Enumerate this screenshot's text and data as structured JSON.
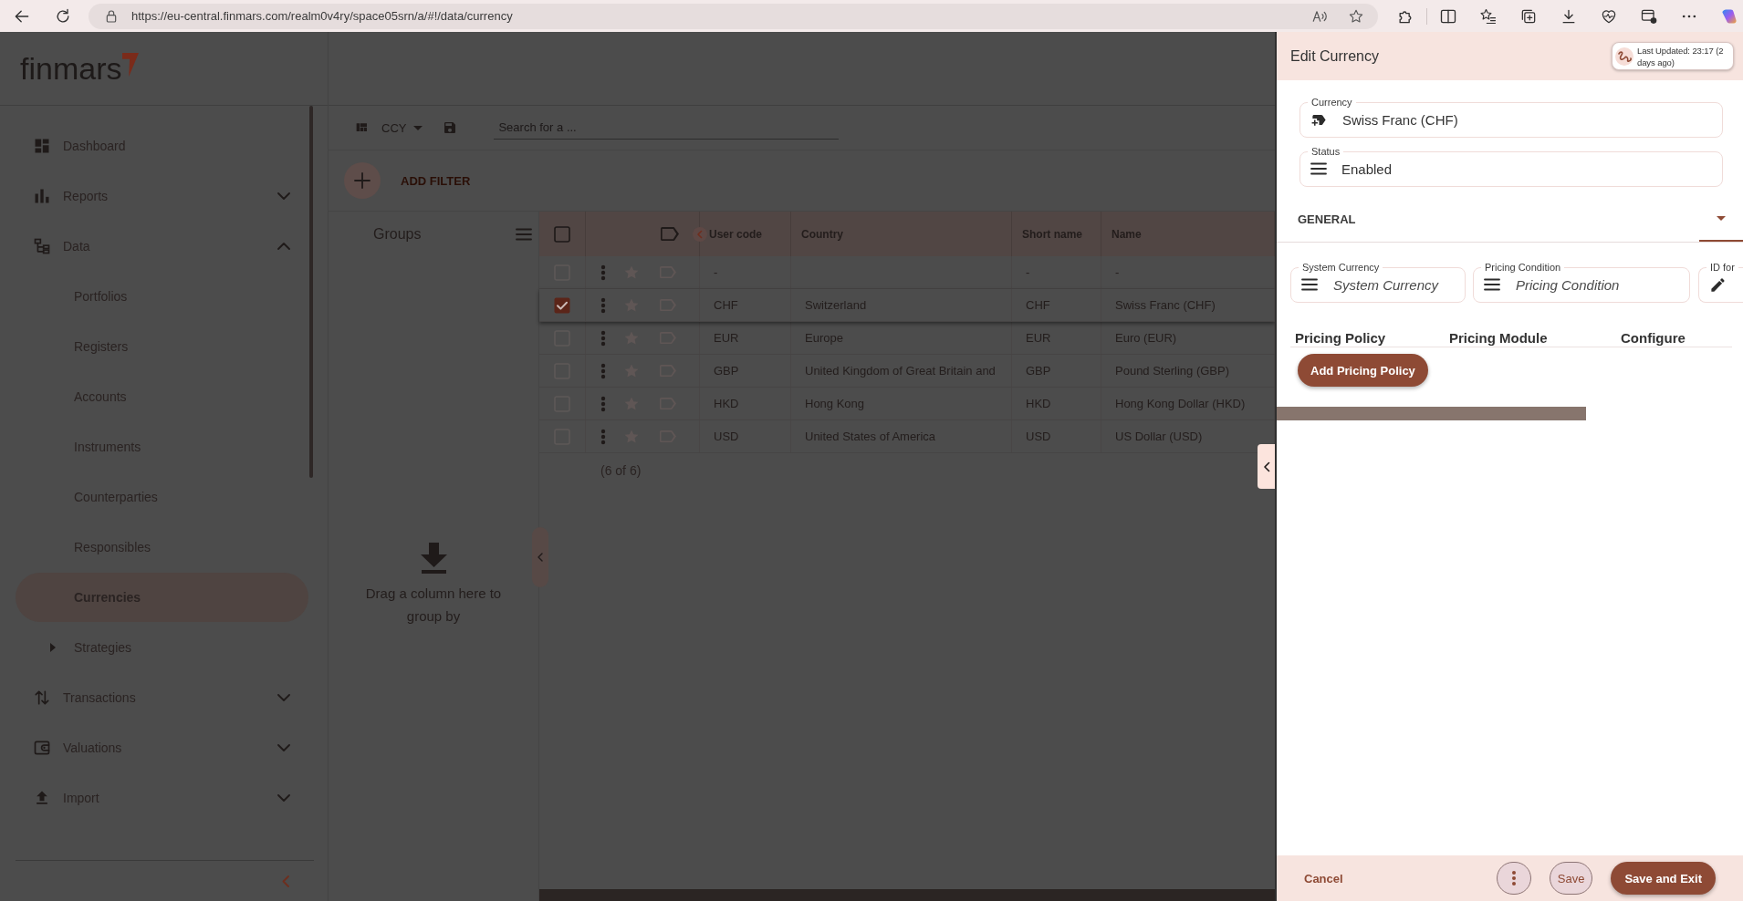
{
  "browser": {
    "url": "https://eu-central.finmars.com/realm0v4ry/space05srn/a/#!/data/currency"
  },
  "sidebar": {
    "logo": "finmars",
    "items": [
      {
        "kind": "link",
        "label": "Dashboard",
        "selected": false
      },
      {
        "kind": "group",
        "label": "Reports",
        "selected": false,
        "expanded": false
      },
      {
        "kind": "group",
        "label": "Data",
        "selected": false,
        "expanded": true,
        "children": [
          {
            "kind": "link",
            "label": "Portfolios",
            "selected": false
          },
          {
            "kind": "link",
            "label": "Registers",
            "selected": false
          },
          {
            "kind": "link",
            "label": "Accounts",
            "selected": false
          },
          {
            "kind": "link",
            "label": "Instruments",
            "selected": false
          },
          {
            "kind": "link",
            "label": "Counterparties",
            "selected": false
          },
          {
            "kind": "link",
            "label": "Responsibles",
            "selected": false
          },
          {
            "kind": "link",
            "label": "Currencies",
            "selected": true
          },
          {
            "kind": "group",
            "label": "Strategies",
            "selected": false,
            "expanded": false
          }
        ]
      },
      {
        "kind": "group",
        "label": "Transactions",
        "selected": false,
        "expanded": false
      },
      {
        "kind": "group",
        "label": "Valuations",
        "selected": false,
        "expanded": false
      },
      {
        "kind": "group",
        "label": "Import",
        "selected": false,
        "expanded": false
      }
    ]
  },
  "toolbar": {
    "layout": "CCY",
    "search": {
      "placeholder": "Search for a ..."
    }
  },
  "filters": {
    "add_label": "ADD FILTER"
  },
  "groups": {
    "title": "Groups",
    "hint": "Drag a column here to group by"
  },
  "table": {
    "select_all": {
      "checked": false
    },
    "columns": {
      "user_code": "User code",
      "country": "Country",
      "short_name": "Short name",
      "name": "Name"
    },
    "rows": [
      {
        "checked": false,
        "starred": false,
        "cells": {
          "user_code": "-",
          "short_name": "-",
          "name": "-"
        }
      },
      {
        "checked": true,
        "starred": false,
        "cells": {
          "user_code": "CHF",
          "country": "Switzerland",
          "short_name": "CHF",
          "name": "Swiss Franc (CHF)"
        }
      },
      {
        "checked": false,
        "starred": false,
        "cells": {
          "user_code": "EUR",
          "country": "Europe",
          "short_name": "EUR",
          "name": "Euro (EUR)"
        }
      },
      {
        "checked": false,
        "starred": false,
        "cells": {
          "user_code": "GBP",
          "country": "United Kingdom of Great Britain and",
          "short_name": "GBP",
          "name": "Pound Sterling (GBP)"
        }
      },
      {
        "checked": false,
        "starred": false,
        "cells": {
          "user_code": "HKD",
          "country": "Hong Kong",
          "short_name": "HKD",
          "name": "Hong Kong Dollar (HKD)"
        }
      },
      {
        "checked": false,
        "starred": false,
        "cells": {
          "user_code": "USD",
          "country": "United States of America",
          "short_name": "USD",
          "name": "US Dollar (USD)"
        }
      }
    ],
    "count": "(6 of 6)"
  },
  "panel": {
    "title": "Edit Currency",
    "last_updated": "Last Updated: 23:17 (2 days ago)",
    "fields": [
      {
        "label": "Currency",
        "value": "Swiss Franc (CHF)"
      },
      {
        "label": "Status",
        "value": "Enabled"
      }
    ],
    "section": "GENERAL",
    "general_fields": [
      {
        "label": "System Currency",
        "placeholder": "System Currency"
      },
      {
        "label": "Pricing Condition",
        "placeholder": "Pricing Condition"
      },
      {
        "label": "ID for"
      }
    ],
    "pricing_columns": [
      "Pricing Policy",
      "Pricing Module",
      "Configure"
    ],
    "add_button": "Add Pricing Policy",
    "footer": {
      "cancel": "Cancel",
      "save": "Save",
      "save_and_exit": "Save and Exit"
    }
  }
}
